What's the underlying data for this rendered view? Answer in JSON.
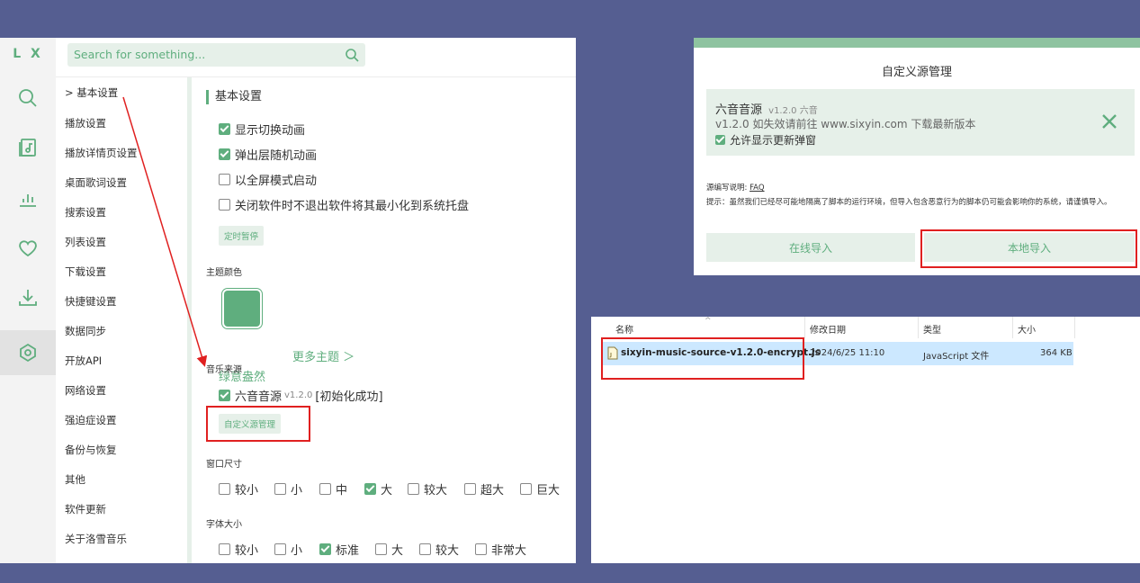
{
  "app": {
    "logo": "L X",
    "search_placeholder": "Search for something...",
    "nav_items": [
      "> 基本设置",
      "播放设置",
      "播放详情页设置",
      "桌面歌词设置",
      "搜索设置",
      "列表设置",
      "下载设置",
      "快捷键设置",
      "数据同步",
      "开放API",
      "网络设置",
      "强迫症设置",
      "备份与恢复",
      "其他",
      "软件更新",
      "关于洛雪音乐"
    ],
    "section_title": "基本设置",
    "basic_options": [
      {
        "label": "显示切换动画",
        "checked": true
      },
      {
        "label": "弹出层随机动画",
        "checked": true
      },
      {
        "label": "以全屏模式启动",
        "checked": false
      },
      {
        "label": "关闭软件时不退出软件将其最小化到系统托盘",
        "checked": false
      }
    ],
    "timer_button": "定时暂停",
    "theme_label": "主题颜色",
    "theme_name": "绿意盎然",
    "more_themes": "更多主题 ＞",
    "source_label": "音乐来源",
    "source_name": "六音音源",
    "source_version": "v1.2.0",
    "source_status": "[初始化成功]",
    "custom_source_button": "自定义源管理",
    "window_size_label": "窗口尺寸",
    "window_sizes": [
      {
        "label": "较小",
        "checked": false
      },
      {
        "label": "小",
        "checked": false
      },
      {
        "label": "中",
        "checked": false
      },
      {
        "label": "大",
        "checked": true
      },
      {
        "label": "较大",
        "checked": false
      },
      {
        "label": "超大",
        "checked": false
      },
      {
        "label": "巨大",
        "checked": false
      }
    ],
    "font_size_label": "字体大小",
    "font_sizes": [
      {
        "label": "较小",
        "checked": false
      },
      {
        "label": "小",
        "checked": false
      },
      {
        "label": "标准",
        "checked": true
      },
      {
        "label": "大",
        "checked": false
      },
      {
        "label": "较大",
        "checked": false
      },
      {
        "label": "非常大",
        "checked": false
      }
    ],
    "accent_color": "#5fae7e"
  },
  "dialog": {
    "title": "自定义源管理",
    "source_name": "六音音源",
    "source_version": "v1.2.0 六音",
    "source_desc": "v1.2.0 如失效请前往 www.sixyin.com 下载最新版本",
    "allow_update_popup": "允许显示更新弹窗",
    "hint_label": "源编写说明:",
    "faq": "FAQ",
    "warning": "提示：虽然我们已经尽可能地隔离了脚本的运行环境，但导入包含恶意行为的脚本仍可能会影响你的系统，请谨慎导入。",
    "online_import": "在线导入",
    "local_import": "本地导入"
  },
  "explorer": {
    "columns": [
      "名称",
      "修改日期",
      "类型",
      "大小"
    ],
    "file": {
      "name": "sixyin-music-source-v1.2.0-encrypt.js",
      "modified": "2024/6/25 11:10",
      "type": "JavaScript 文件",
      "size": "364 KB"
    }
  }
}
